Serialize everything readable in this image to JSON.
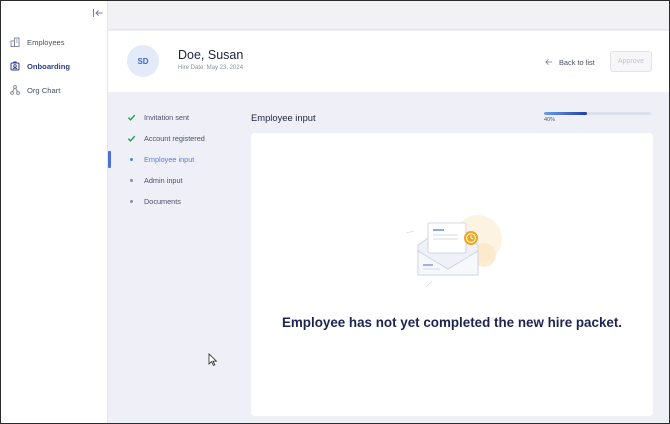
{
  "sidebar": {
    "items": [
      {
        "label": "Employees",
        "icon": "building-icon",
        "active": false
      },
      {
        "label": "Onboarding",
        "icon": "id-badge-icon",
        "active": true
      },
      {
        "label": "Org Chart",
        "icon": "org-chart-icon",
        "active": false
      }
    ]
  },
  "employee": {
    "initials": "SD",
    "name": "Doe, Susan",
    "hire_date": "Hire Date: May 23, 2024"
  },
  "header": {
    "back_label": "Back to list",
    "approve_label": "Approve"
  },
  "steps": [
    {
      "label": "Invitation sent",
      "status": "complete"
    },
    {
      "label": "Account registered",
      "status": "complete"
    },
    {
      "label": "Employee input",
      "status": "current"
    },
    {
      "label": "Admin input",
      "status": "pending"
    },
    {
      "label": "Documents",
      "status": "pending"
    }
  ],
  "section": {
    "title": "Employee input",
    "progress_percent": 40,
    "progress_label": "40%"
  },
  "empty_state": {
    "message": "Employee has not yet completed the new hire packet.",
    "icon": "envelope-clock-icon"
  },
  "colors": {
    "accent": "#4a6fd9",
    "check": "#27a05a",
    "clock": "#f0a51c",
    "text_dark": "#1f2350"
  }
}
